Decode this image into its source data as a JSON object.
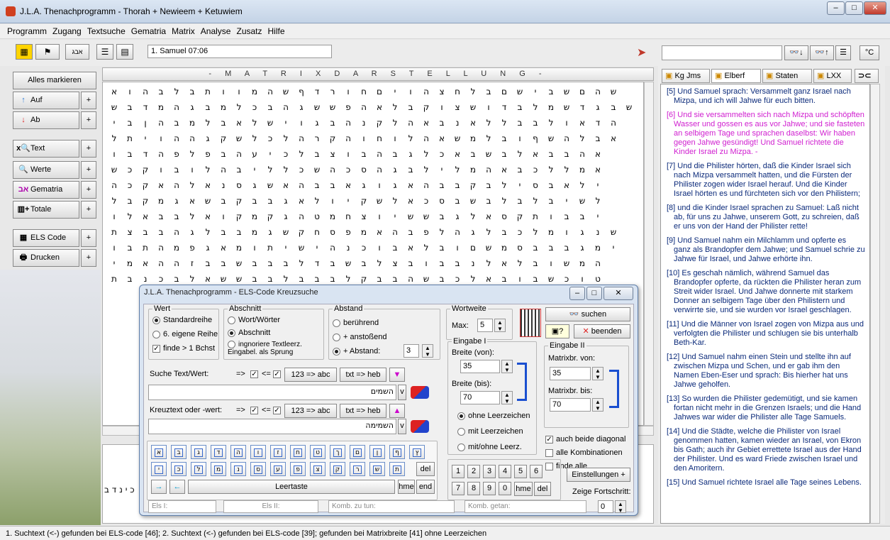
{
  "window": {
    "title": "J.L.A. Thenachprogramm - Thorah + Newieem + Ketuwiem"
  },
  "menu": [
    "Programm",
    "Zugang",
    "Textsuche",
    "Gematria",
    "Matrix",
    "Analyse",
    "Zusatz",
    "Hilfe"
  ],
  "toolbar": {
    "reference": "1. Samuel 07:06"
  },
  "left": {
    "mark_all": "Alles markieren",
    "up": "Auf",
    "down": "Ab",
    "text": "Text",
    "values": "Werte",
    "gematria": "Gematria",
    "totals": "Totale",
    "els": "ELS Code",
    "print": "Drucken",
    "plus": "+"
  },
  "matrix": {
    "header": "- M A T R I X D A R S T E L L U N G -",
    "rows": [
      "אוהבלבתוומהשףדרוחםיוהצחלבםשיבשםהש",
      "שבדמהגבמלכבהגששפהאלבקוצשודבלמשדגבש",
      "יבןהבמלבאלשיוגבהנקלהאבנאללבבלואדה",
      "לתיוההגקשלכלהרקהוחולהאשמלבוףשהלבא",
      "ובדהפלפבהעיכלבצובהבגלכאבשבלאבבהא",
      "שכקובולהביללכשהכסהגבלילמהאבכללמא",
      "הכקאהלאנסגשאהבבאגוגאהבבקבליסבאלי",
      "לבקמגאשבקבבגאלויקשלאכסבשבלבלבישל",
      "ולאבבלאוקמקגהטמחצויששבגלאסקתובבי",
      "תצבבהגלבבמגשקחספמאהבפלהגלבכלמוגנש",
      "ובתהמפגאמותישיהנכובאלבוםשמסבבבגמי",
      "ימאההזבבשבבבלדבשבלצבובבנלאלבושמה",
      "תבנכבלאששבבלבבבלקבבהשבכלאבובשכוט"
    ]
  },
  "lower": {
    "hebrew": "כ י נ ד ב"
  },
  "right": {
    "tabs": [
      "Kg Jms",
      "Elberf",
      "Staten",
      "LXX"
    ],
    "verses": [
      {
        "num": "[5]",
        "text": "Und Samuel sprach: Versammelt ganz Israel nach Mizpa, und ich will Jahwe für euch bitten."
      },
      {
        "num": "[6]",
        "text": "Und sie versammelten sich nach Mizpa und schöpften Wasser und gossen es aus vor Jahwe; und sie fasteten an selbigem Tage und sprachen daselbst: Wir haben gegen Jahwe gesündigt! Und Samuel richtete die Kinder Israel zu Mizpa. -"
      },
      {
        "num": "[7]",
        "text": "Und die Philister hörten, daß die Kinder Israel sich nach Mizpa versammelt hatten, und die Fürsten der Philister zogen wider Israel herauf. Und die Kinder Israel hörten es und fürchteten sich vor den Philistern;"
      },
      {
        "num": "[8]",
        "text": "und die Kinder Israel sprachen zu Samuel: Laß nicht ab, für uns zu Jahwe, unserem Gott, zu schreien, daß er uns von der Hand der Philister rette!"
      },
      {
        "num": "[9]",
        "text": "Und Samuel nahm ein Milchlamm und opferte es ganz als Brandopfer dem Jahwe; und Samuel schrie zu Jahwe für Israel, und Jahwe erhörte ihn."
      },
      {
        "num": "[10]",
        "text": "Es geschah nämlich, während Samuel das Brandopfer opferte, da rückten die Philister heran zum Streit wider Israel. Und Jahwe donnerte mit starkem Donner an selbigem Tage über den Philistern und verwirrte sie, und sie wurden vor Israel geschlagen."
      },
      {
        "num": "[11]",
        "text": "Und die Männer von Israel zogen von Mizpa aus und verfolgten die Philister und schlugen sie bis unterhalb Beth-Kar."
      },
      {
        "num": "[12]",
        "text": "Und Samuel nahm einen Stein und stellte ihn auf zwischen Mizpa und Schen, und er gab ihm den Namen Eben-Eser und sprach: Bis hierher hat uns Jahwe geholfen."
      },
      {
        "num": "[13]",
        "text": "So wurden die Philister gedemütigt, und sie kamen fortan nicht mehr in die Grenzen Israels; und die Hand Jahwes war wider die Philister alle Tage Samuels."
      },
      {
        "num": "[14]",
        "text": "Und die Städte, welche die Philister von Israel genommen hatten, kamen wieder an Israel, von Ekron bis Gath; auch ihr Gebiet errettete Israel aus der Hand der Philister. Und es ward Friede zwischen Israel und den Amoritern."
      },
      {
        "num": "[15]",
        "text": "Und Samuel richtete Israel alle Tage seines Lebens."
      }
    ]
  },
  "dialog": {
    "title": "J.L.A. Thenachprogramm - ELS-Code Kreuzsuche",
    "wert": {
      "label": "Wert",
      "opt1": "Standardreihe",
      "opt2": "6. eigene Reihe",
      "opt3": "finde > 1 Bchst"
    },
    "abschnitt": {
      "label": "Abschnitt",
      "opt1": "Wort/Wörter",
      "opt2": "Abschnitt",
      "opt3": "ingnoriere Textleerz. Eingabel. als Sprung"
    },
    "abstand": {
      "label": "Abstand",
      "opt1": "berührend",
      "opt2": "+ anstoßend",
      "opt3": "+ Abstand:",
      "value": "3"
    },
    "wortweite": {
      "label": "Wortweite",
      "max_label": "Max:",
      "max": "5"
    },
    "search_btn": "suchen",
    "quit_btn": "beenden",
    "suche_label": "Suche Text/Wert:",
    "kreuz_label": "Kreuztext oder -wert:",
    "arrows": "=>",
    "le": "<=",
    "conv1": "123 => abc",
    "conv2": "txt => heb",
    "v": "v",
    "search_text": "השמים",
    "cross_text": "השמימה",
    "eingabe1": {
      "label": "Eingabe I",
      "from_label": "Breite (von):",
      "from": "35",
      "to_label": "Breite (bis):",
      "to": "70",
      "r1": "ohne Leerzeichen",
      "r2": "mit Leerzeichen",
      "r3": "mit/ohne Leerz."
    },
    "eingabe2": {
      "label": "Eingabe II",
      "from_label": "Matrixbr. von:",
      "from": "35",
      "to_label": "Matrixbr. bis:",
      "to": "70"
    },
    "cb1": "auch beide diagonal",
    "cb2": "alle Kombinationen",
    "cb3": "finde alle",
    "keys1": [
      "א",
      "ב",
      "ג",
      "ד",
      "ה",
      "ו",
      "ז",
      "ח",
      "ט",
      "ך",
      "ם",
      "ן",
      "ף",
      "ץ"
    ],
    "keys2": [
      "י",
      "כ",
      "ל",
      "מ",
      "נ",
      "ס",
      "ע",
      "פ",
      "צ",
      "ק",
      "ר",
      "ש",
      "ת"
    ],
    "del": "del",
    "space": "Leertaste",
    "hme": "hme",
    "end": "end",
    "nums1": [
      "1",
      "2",
      "3",
      "4",
      "5",
      "6"
    ],
    "nums2": [
      "7",
      "8",
      "9",
      "0"
    ],
    "settings": "Einstellungen +",
    "progress": "Zeige Fortschritt:",
    "progress_val": "0",
    "els1": "Els I:",
    "els2": "Els II:",
    "komb_todo": "Komb. zu tun:",
    "komb_done": "Komb. getan:"
  },
  "status": "1. Suchtext (<-) gefunden bei ELS-code [46];   2. Suchtext (<-) gefunden bei ELS-code [39];  gefunden bei Matrixbreite [41] ohne Leerzeichen"
}
